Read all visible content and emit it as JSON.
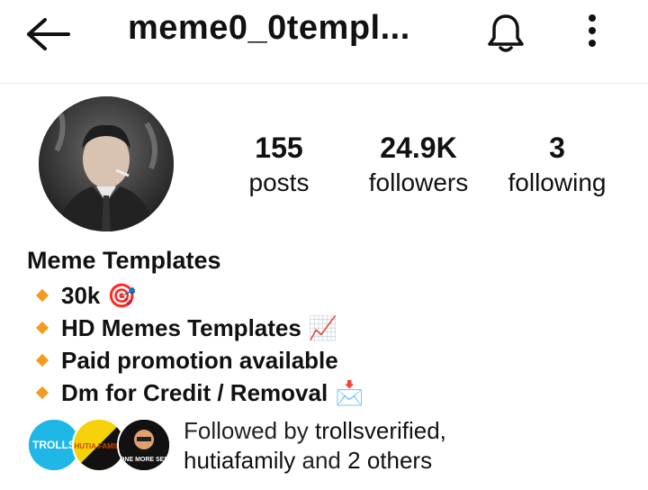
{
  "header": {
    "username": "meme0_0templ...",
    "back_icon": "arrow-left-icon",
    "bell_icon": "bell-icon",
    "more_icon": "more-vertical-icon"
  },
  "stats": [
    {
      "value": "155",
      "label": "posts"
    },
    {
      "value": "24.9K",
      "label": "followers"
    },
    {
      "value": "3",
      "label": "following"
    }
  ],
  "profile": {
    "name": "Meme Templates",
    "bio": [
      {
        "text": "30k",
        "emoji": "🎯"
      },
      {
        "text": "HD Memes Templates",
        "emoji": "📈"
      },
      {
        "text": "Paid promotion available",
        "emoji": ""
      },
      {
        "text": "Dm for Credit / Removal",
        "emoji": "📩"
      }
    ]
  },
  "followed_by": {
    "prefix": "Followed by",
    "user1": "trollsverified,",
    "user2": "hutiafamily",
    "and": "and",
    "others": "2 others",
    "avatars": [
      {
        "text": "TROLLS",
        "color": "#1fb8e6"
      },
      {
        "text": "HUTIA FAMILY",
        "color": "#f5d20a"
      },
      {
        "text": "ONE MORE SEE",
        "color": "#111111"
      }
    ]
  }
}
